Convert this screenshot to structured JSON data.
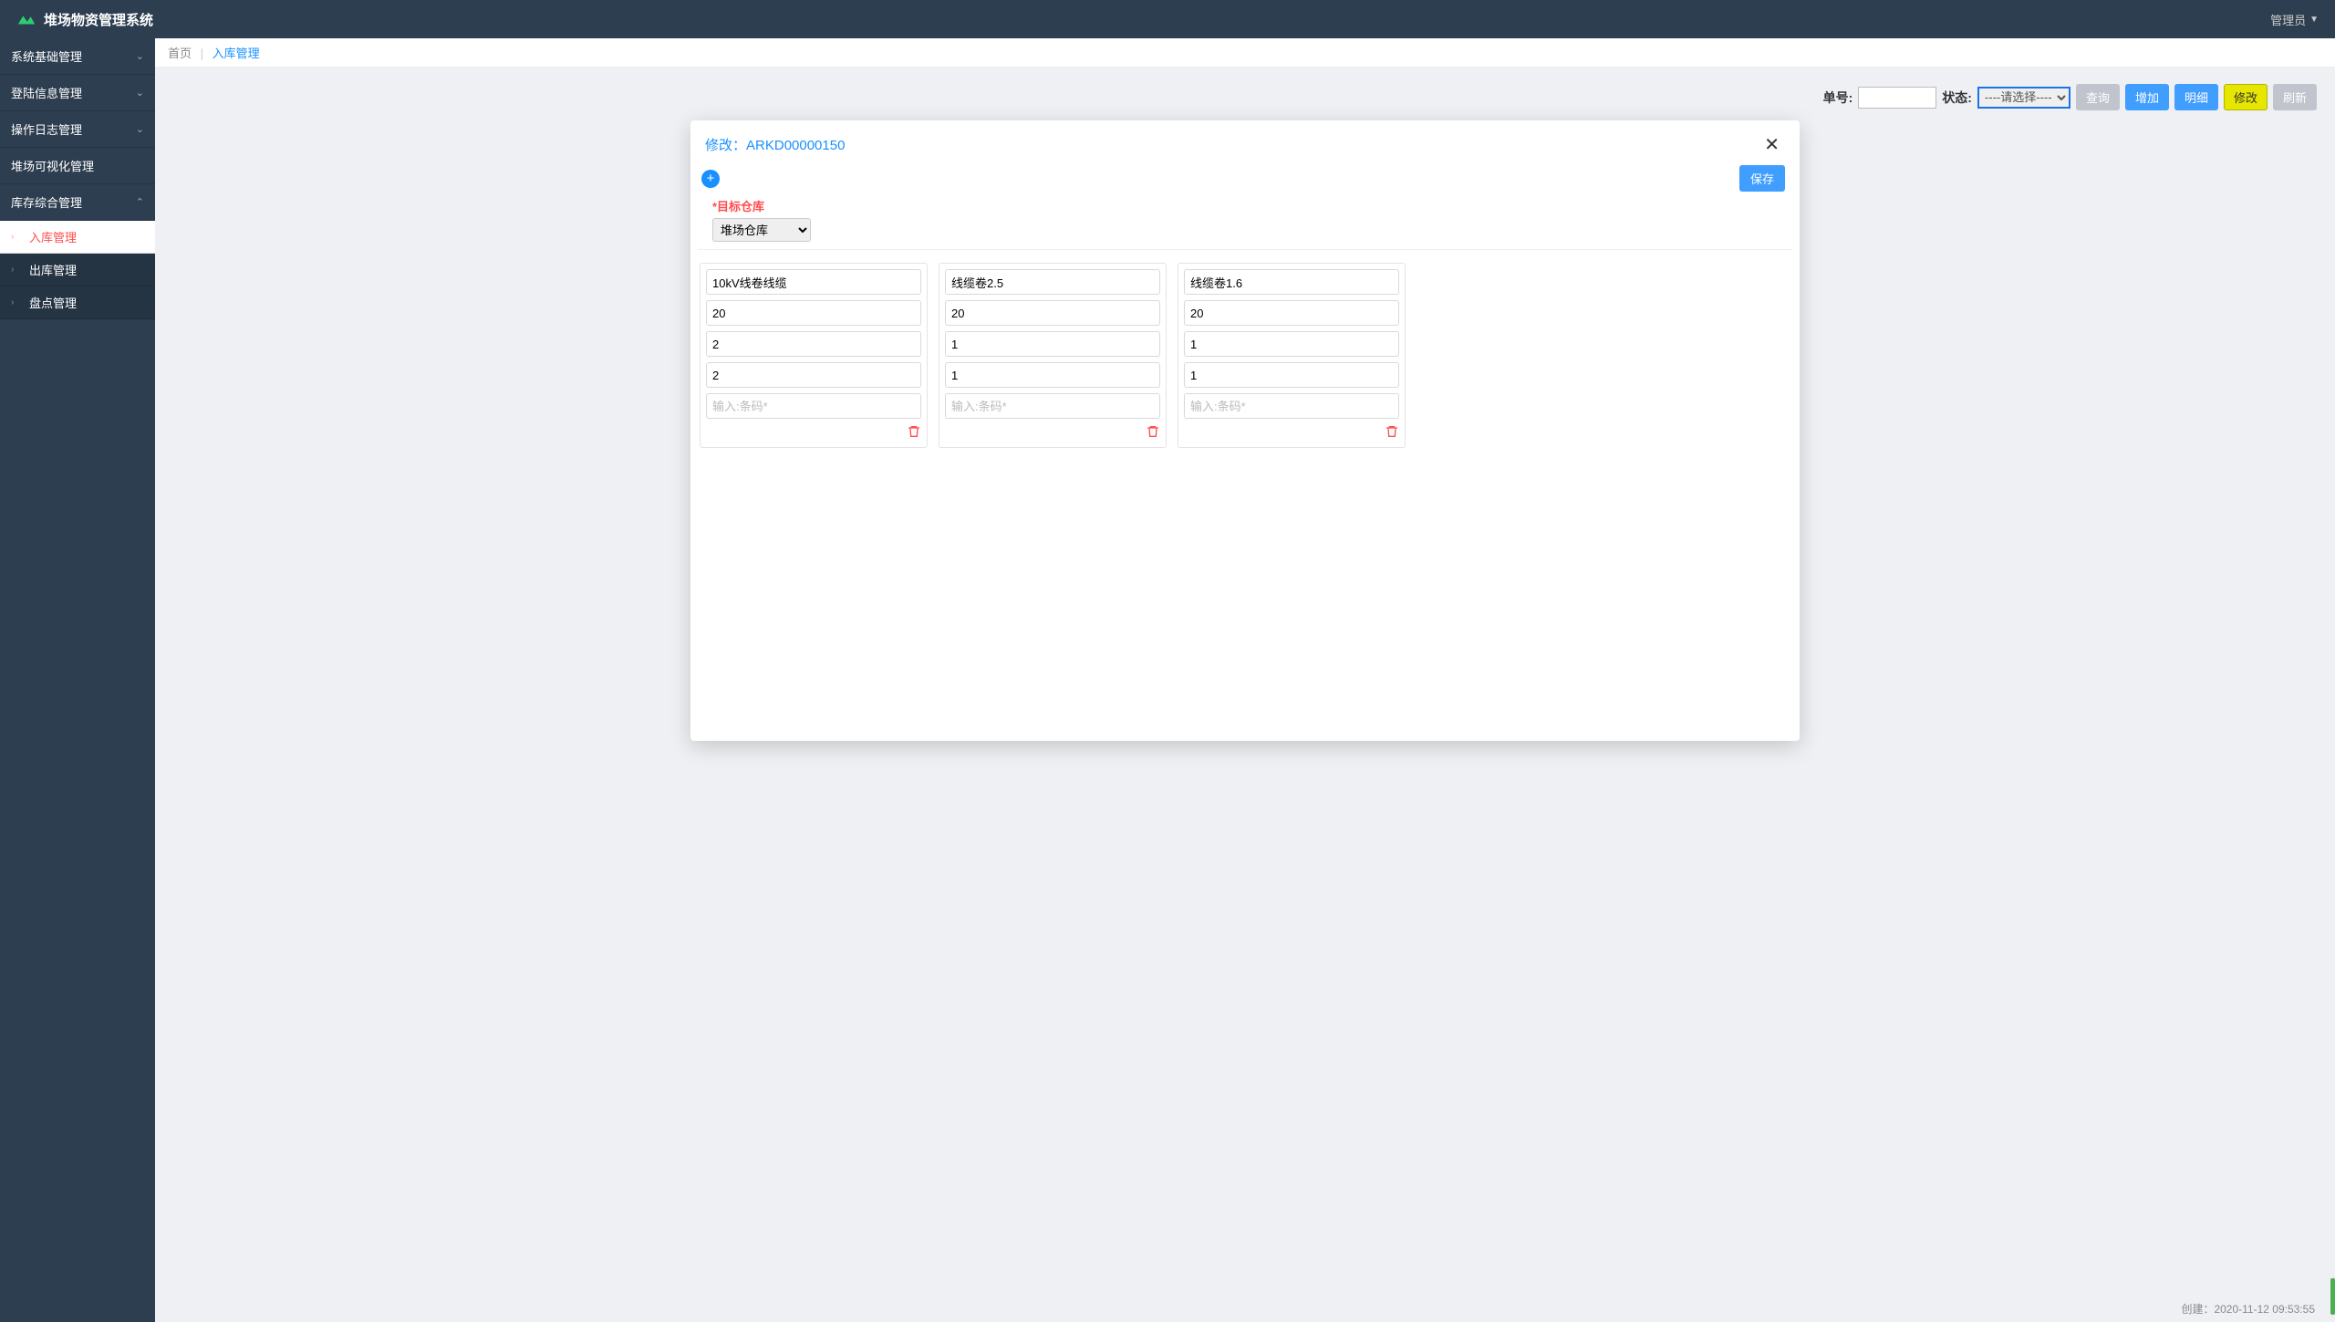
{
  "brand": "堆场物资管理系统",
  "user": {
    "name": "管理员"
  },
  "sidebar": {
    "items": [
      {
        "label": "系统基础管理",
        "expandable": true,
        "open": false
      },
      {
        "label": "登陆信息管理",
        "expandable": true,
        "open": false
      },
      {
        "label": "操作日志管理",
        "expandable": true,
        "open": false
      },
      {
        "label": "堆场可视化管理",
        "expandable": false
      },
      {
        "label": "库存综合管理",
        "expandable": true,
        "open": true,
        "children": [
          {
            "label": "入库管理",
            "active": true
          },
          {
            "label": "出库管理",
            "active": false
          },
          {
            "label": "盘点管理",
            "active": false
          }
        ]
      }
    ]
  },
  "breadcrumb": {
    "home": "首页",
    "current": "入库管理"
  },
  "filters": {
    "order_label": "单号:",
    "order_value": "",
    "status_label": "状态:",
    "status_placeholder": "----请选择----"
  },
  "buttons": {
    "query": "查询",
    "add": "增加",
    "detail": "明细",
    "edit": "修改",
    "refresh": "刷新"
  },
  "modal": {
    "title_prefix": "修改：",
    "order_no": "ARKD00000150",
    "save": "保存",
    "target_label": "*目标仓库",
    "target_value": "堆场仓库",
    "barcode_placeholder": "输入:条码*",
    "items": [
      {
        "name": "10kV线卷线缆",
        "f2": "20",
        "f3": "2",
        "f4": "2",
        "barcode": ""
      },
      {
        "name": "线缆卷2.5",
        "f2": "20",
        "f3": "1",
        "f4": "1",
        "barcode": ""
      },
      {
        "name": "线缆卷1.6",
        "f2": "20",
        "f3": "1",
        "f4": "1",
        "barcode": ""
      }
    ]
  },
  "bg_meta": {
    "created_label": "创建：",
    "created_value": "2020-11-12 09:53:55"
  }
}
